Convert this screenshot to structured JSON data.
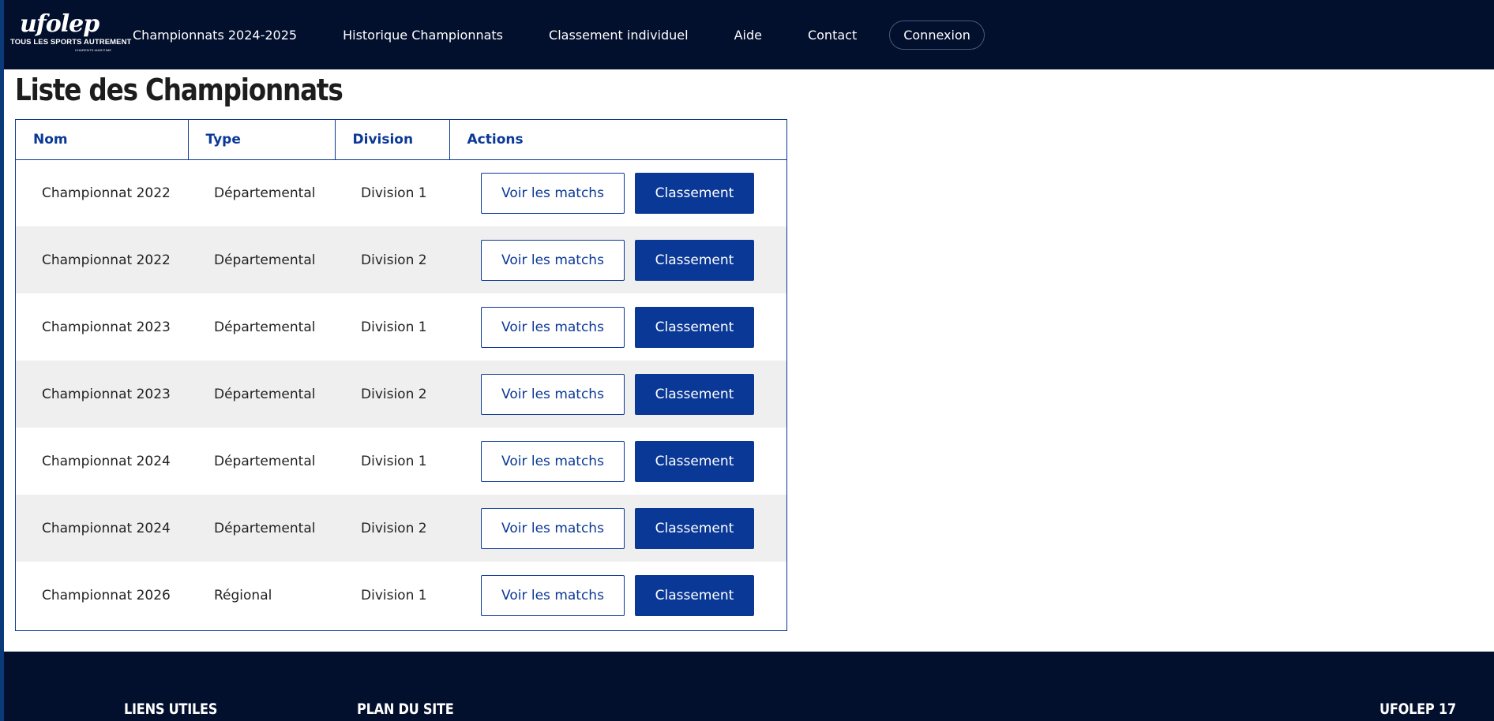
{
  "brand": {
    "logo_word": "ufolep",
    "logo_tagline": "TOUS LES SPORTS AUTREMENT",
    "logo_sub": "CHARENTE-MARITIME"
  },
  "nav": {
    "items": [
      {
        "label": "Championnats 2024-2025"
      },
      {
        "label": "Historique Championnats"
      },
      {
        "label": "Classement individuel"
      },
      {
        "label": "Aide"
      },
      {
        "label": "Contact"
      }
    ],
    "login_label": "Connexion"
  },
  "page": {
    "title": "Liste des Championnats"
  },
  "table": {
    "headers": [
      "Nom",
      "Type",
      "Division",
      "Actions"
    ],
    "view_matches_label": "Voir les matchs",
    "ranking_label": "Classement",
    "rows": [
      {
        "name": "Championnat 2022",
        "type": "Départemental",
        "division": "Division 1"
      },
      {
        "name": "Championnat 2022",
        "type": "Départemental",
        "division": "Division 2"
      },
      {
        "name": "Championnat 2023",
        "type": "Départemental",
        "division": "Division 1"
      },
      {
        "name": "Championnat 2023",
        "type": "Départemental",
        "division": "Division 2"
      },
      {
        "name": "Championnat 2024",
        "type": "Départemental",
        "division": "Division 1"
      },
      {
        "name": "Championnat 2024",
        "type": "Départemental",
        "division": "Division 2"
      },
      {
        "name": "Championnat 2026",
        "type": "Régional",
        "division": "Division 1"
      }
    ]
  },
  "footer": {
    "useful_links": "LIENS UTILES",
    "sitemap": "PLAN DU SITE",
    "org": "UFOLEP 17"
  },
  "colors": {
    "navy": "#020f2d",
    "accent": "#0a3896",
    "row_alt": "#efefef"
  }
}
